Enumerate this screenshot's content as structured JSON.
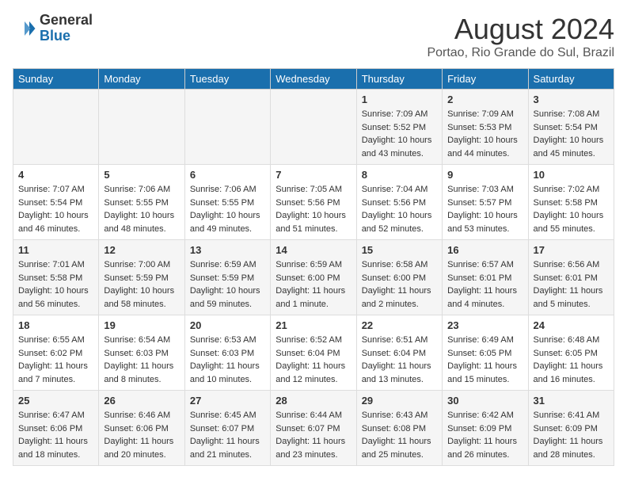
{
  "logo": {
    "general": "General",
    "blue": "Blue"
  },
  "title": {
    "month_year": "August 2024",
    "location": "Portao, Rio Grande do Sul, Brazil"
  },
  "days_of_week": [
    "Sunday",
    "Monday",
    "Tuesday",
    "Wednesday",
    "Thursday",
    "Friday",
    "Saturday"
  ],
  "weeks": [
    [
      {
        "day": "",
        "info": ""
      },
      {
        "day": "",
        "info": ""
      },
      {
        "day": "",
        "info": ""
      },
      {
        "day": "",
        "info": ""
      },
      {
        "day": "1",
        "info": "Sunrise: 7:09 AM\nSunset: 5:52 PM\nDaylight: 10 hours\nand 43 minutes."
      },
      {
        "day": "2",
        "info": "Sunrise: 7:09 AM\nSunset: 5:53 PM\nDaylight: 10 hours\nand 44 minutes."
      },
      {
        "day": "3",
        "info": "Sunrise: 7:08 AM\nSunset: 5:54 PM\nDaylight: 10 hours\nand 45 minutes."
      }
    ],
    [
      {
        "day": "4",
        "info": "Sunrise: 7:07 AM\nSunset: 5:54 PM\nDaylight: 10 hours\nand 46 minutes."
      },
      {
        "day": "5",
        "info": "Sunrise: 7:06 AM\nSunset: 5:55 PM\nDaylight: 10 hours\nand 48 minutes."
      },
      {
        "day": "6",
        "info": "Sunrise: 7:06 AM\nSunset: 5:55 PM\nDaylight: 10 hours\nand 49 minutes."
      },
      {
        "day": "7",
        "info": "Sunrise: 7:05 AM\nSunset: 5:56 PM\nDaylight: 10 hours\nand 51 minutes."
      },
      {
        "day": "8",
        "info": "Sunrise: 7:04 AM\nSunset: 5:56 PM\nDaylight: 10 hours\nand 52 minutes."
      },
      {
        "day": "9",
        "info": "Sunrise: 7:03 AM\nSunset: 5:57 PM\nDaylight: 10 hours\nand 53 minutes."
      },
      {
        "day": "10",
        "info": "Sunrise: 7:02 AM\nSunset: 5:58 PM\nDaylight: 10 hours\nand 55 minutes."
      }
    ],
    [
      {
        "day": "11",
        "info": "Sunrise: 7:01 AM\nSunset: 5:58 PM\nDaylight: 10 hours\nand 56 minutes."
      },
      {
        "day": "12",
        "info": "Sunrise: 7:00 AM\nSunset: 5:59 PM\nDaylight: 10 hours\nand 58 minutes."
      },
      {
        "day": "13",
        "info": "Sunrise: 6:59 AM\nSunset: 5:59 PM\nDaylight: 10 hours\nand 59 minutes."
      },
      {
        "day": "14",
        "info": "Sunrise: 6:59 AM\nSunset: 6:00 PM\nDaylight: 11 hours\nand 1 minute."
      },
      {
        "day": "15",
        "info": "Sunrise: 6:58 AM\nSunset: 6:00 PM\nDaylight: 11 hours\nand 2 minutes."
      },
      {
        "day": "16",
        "info": "Sunrise: 6:57 AM\nSunset: 6:01 PM\nDaylight: 11 hours\nand 4 minutes."
      },
      {
        "day": "17",
        "info": "Sunrise: 6:56 AM\nSunset: 6:01 PM\nDaylight: 11 hours\nand 5 minutes."
      }
    ],
    [
      {
        "day": "18",
        "info": "Sunrise: 6:55 AM\nSunset: 6:02 PM\nDaylight: 11 hours\nand 7 minutes."
      },
      {
        "day": "19",
        "info": "Sunrise: 6:54 AM\nSunset: 6:03 PM\nDaylight: 11 hours\nand 8 minutes."
      },
      {
        "day": "20",
        "info": "Sunrise: 6:53 AM\nSunset: 6:03 PM\nDaylight: 11 hours\nand 10 minutes."
      },
      {
        "day": "21",
        "info": "Sunrise: 6:52 AM\nSunset: 6:04 PM\nDaylight: 11 hours\nand 12 minutes."
      },
      {
        "day": "22",
        "info": "Sunrise: 6:51 AM\nSunset: 6:04 PM\nDaylight: 11 hours\nand 13 minutes."
      },
      {
        "day": "23",
        "info": "Sunrise: 6:49 AM\nSunset: 6:05 PM\nDaylight: 11 hours\nand 15 minutes."
      },
      {
        "day": "24",
        "info": "Sunrise: 6:48 AM\nSunset: 6:05 PM\nDaylight: 11 hours\nand 16 minutes."
      }
    ],
    [
      {
        "day": "25",
        "info": "Sunrise: 6:47 AM\nSunset: 6:06 PM\nDaylight: 11 hours\nand 18 minutes."
      },
      {
        "day": "26",
        "info": "Sunrise: 6:46 AM\nSunset: 6:06 PM\nDaylight: 11 hours\nand 20 minutes."
      },
      {
        "day": "27",
        "info": "Sunrise: 6:45 AM\nSunset: 6:07 PM\nDaylight: 11 hours\nand 21 minutes."
      },
      {
        "day": "28",
        "info": "Sunrise: 6:44 AM\nSunset: 6:07 PM\nDaylight: 11 hours\nand 23 minutes."
      },
      {
        "day": "29",
        "info": "Sunrise: 6:43 AM\nSunset: 6:08 PM\nDaylight: 11 hours\nand 25 minutes."
      },
      {
        "day": "30",
        "info": "Sunrise: 6:42 AM\nSunset: 6:09 PM\nDaylight: 11 hours\nand 26 minutes."
      },
      {
        "day": "31",
        "info": "Sunrise: 6:41 AM\nSunset: 6:09 PM\nDaylight: 11 hours\nand 28 minutes."
      }
    ]
  ]
}
